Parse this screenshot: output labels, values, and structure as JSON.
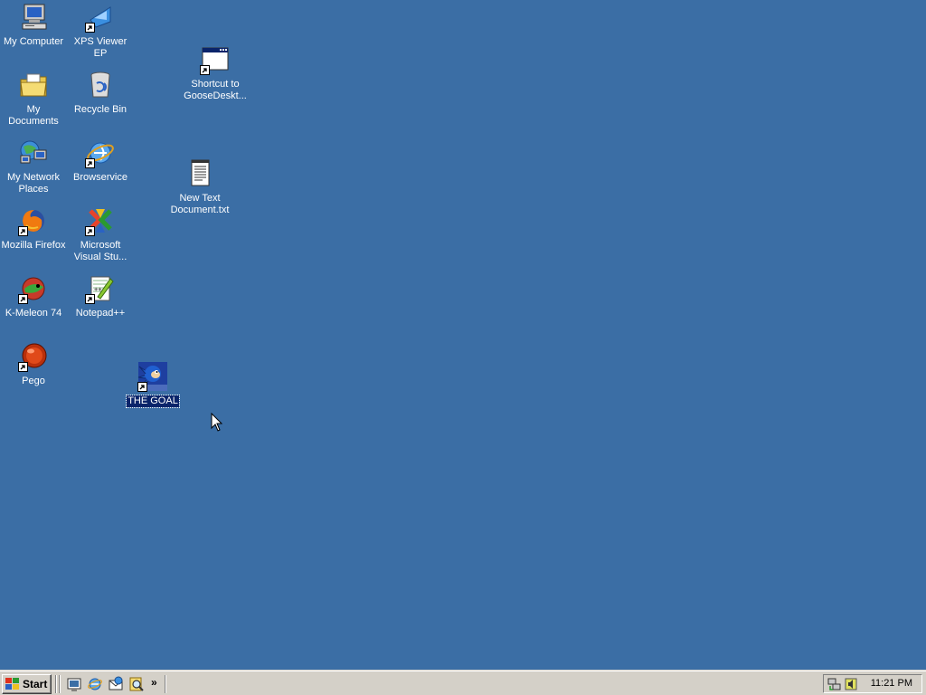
{
  "desktop": {
    "background_color": "#3b6ea5",
    "icons": [
      {
        "label": "My Computer",
        "icon": "my-computer-icon",
        "shortcut": false
      },
      {
        "label": "XPS Viewer EP",
        "icon": "xps-viewer-icon",
        "shortcut": true
      },
      {
        "label": "My Documents",
        "icon": "my-documents-icon",
        "shortcut": false
      },
      {
        "label": "Recycle Bin",
        "icon": "recycle-bin-icon",
        "shortcut": false
      },
      {
        "label": "My Network Places",
        "icon": "network-places-icon",
        "shortcut": false
      },
      {
        "label": "Browservice",
        "icon": "internet-explorer-icon",
        "shortcut": true
      },
      {
        "label": "Mozilla Firefox",
        "icon": "firefox-icon",
        "shortcut": true
      },
      {
        "label": "Microsoft Visual Stu...",
        "icon": "visual-studio-icon",
        "shortcut": true
      },
      {
        "label": "K-Meleon 74",
        "icon": "k-meleon-icon",
        "shortcut": true
      },
      {
        "label": "Notepad++",
        "icon": "notepad-plus-plus-icon",
        "shortcut": true
      },
      {
        "label": "Pego",
        "icon": "pego-icon",
        "shortcut": true
      },
      {
        "label": "THE GOAL",
        "icon": "sonic-image-icon",
        "shortcut": true,
        "selected": true
      },
      {
        "label": "Shortcut to GooseDeskt...",
        "icon": "application-window-icon",
        "shortcut": true
      },
      {
        "label": "New Text Document.txt",
        "icon": "text-document-icon",
        "shortcut": false
      }
    ]
  },
  "taskbar": {
    "start_label": "Start",
    "quick_launch": [
      {
        "icon": "show-desktop-icon"
      },
      {
        "icon": "internet-explorer-icon"
      },
      {
        "icon": "outlook-express-icon"
      },
      {
        "icon": "search-icon"
      }
    ],
    "chevron_label": "»",
    "tray": {
      "icons": [
        {
          "icon": "network-connection-icon"
        },
        {
          "icon": "volume-icon"
        }
      ],
      "clock": "11:21 PM"
    }
  }
}
